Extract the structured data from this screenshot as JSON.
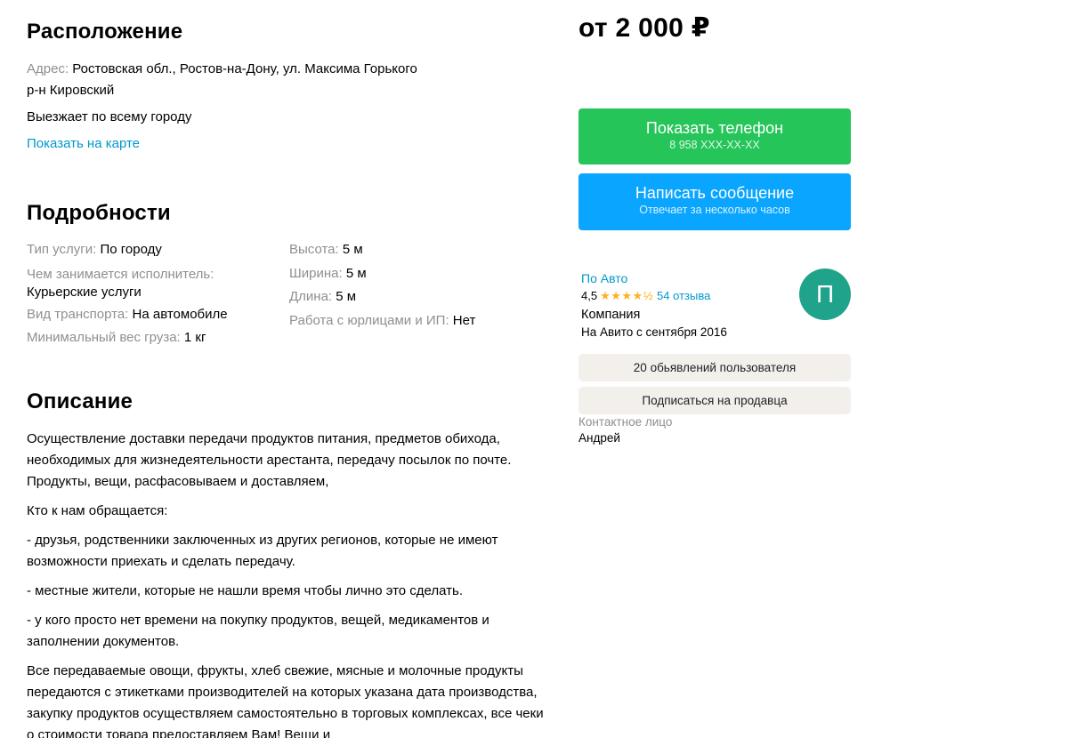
{
  "price": "от 2 000 ₽",
  "location": {
    "title": "Расположение",
    "address_label": "Адрес:",
    "address_value": "Ростовская обл., Ростов-на-Дону, ул. Максима Горького",
    "district": "р-н Кировский",
    "coverage": "Выезжает по всему городу",
    "map_link": "Показать на карте"
  },
  "details": {
    "title": "Подробности",
    "left": [
      {
        "label": "Тип услуги:",
        "value": "По городу"
      },
      {
        "label": "Чем занимается исполнитель:",
        "value": "Курьерские услуги"
      },
      {
        "label": "Вид транспорта:",
        "value": "На автомобиле"
      },
      {
        "label": "Минимальный вес груза:",
        "value": "1 кг"
      }
    ],
    "right": [
      {
        "label": "Высота:",
        "value": "5 м"
      },
      {
        "label": "Ширина:",
        "value": "5 м"
      },
      {
        "label": "Длина:",
        "value": "5 м"
      },
      {
        "label": "Работа с юрлицами и ИП:",
        "value": "Нет"
      }
    ]
  },
  "description": {
    "title": "Описание",
    "paragraphs": [
      "Осуществление доставки передачи продуктов питания, предметов обихода, необходимых для жизнедеятельности арестанта, передачу посылок по почте. Продукты, вещи, расфасовываем и доставляем,",
      "Кто к нам обращается:",
      "- друзья, родственники заключенных из других регионов, которые не имеют возможности приехать и сделать передачу.",
      "- местные жители, которые не нашли время чтобы лично это сделать.",
      "- у кого просто нет времени на покупку продуктов, вещей, медикаментов и заполнении документов.",
      "Все передаваемые овощи, фрукты, хлеб свежие, мясные и молочные продукты передаются с этикетками производителей на которых указана дата производства, закупку продуктов осуществляем самостоятельно в торговых комплексах, все чеки о стоимости товара предоставляем Вам! Вещи и"
    ]
  },
  "actions": {
    "phone_label": "Показать телефон",
    "phone_masked": "8 958 XXX-XX-XX",
    "message_label": "Написать сообщение",
    "message_sub": "Отвечает за несколько часов"
  },
  "seller": {
    "name": "По Авто",
    "rating": "4,5",
    "stars": "★★★★½",
    "reviews": "54 отзыва",
    "type": "Компания",
    "since": "На Авито с сентября 2016",
    "avatar_letter": "П",
    "ads_button": "20 обьявлений пользователя",
    "subscribe_button": "Подписаться на продавца",
    "contact_label": "Контактное лицо",
    "contact_name": "Андрей"
  },
  "colors": {
    "phone_button": "#25c55a",
    "message_button": "#0aa5ff",
    "avatar": "#20a38b",
    "link": "#0099cc",
    "stars": "#ffb021"
  }
}
